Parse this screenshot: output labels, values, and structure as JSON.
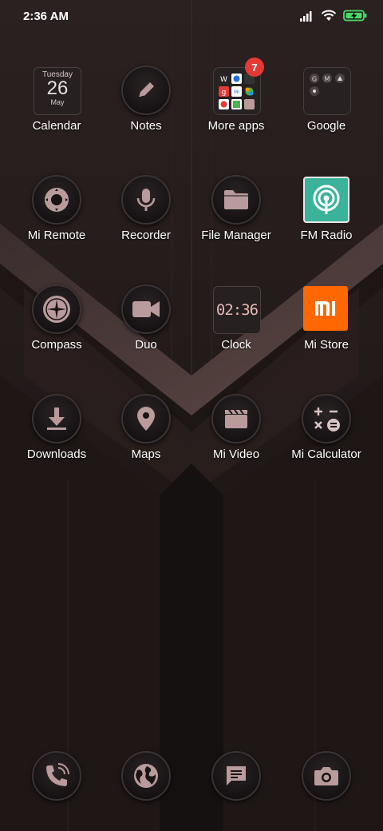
{
  "status": {
    "time": "2:36 AM"
  },
  "calendar": {
    "weekday": "Tuesday",
    "day": "26",
    "month": "May"
  },
  "clock_widget": {
    "text": "02:36"
  },
  "more_apps_badge": "7",
  "apps": [
    {
      "label": "Calendar"
    },
    {
      "label": "Notes"
    },
    {
      "label": "More apps"
    },
    {
      "label": "Google"
    },
    {
      "label": "Mi Remote"
    },
    {
      "label": "Recorder"
    },
    {
      "label": "File Manager"
    },
    {
      "label": "FM Radio"
    },
    {
      "label": "Compass"
    },
    {
      "label": "Duo"
    },
    {
      "label": "Clock"
    },
    {
      "label": "Mi Store"
    },
    {
      "label": "Downloads"
    },
    {
      "label": "Maps"
    },
    {
      "label": "Mi Video"
    },
    {
      "label": "Mi Calculator"
    }
  ],
  "dock": [
    {
      "icon": "phone-icon"
    },
    {
      "icon": "browser-globe-icon"
    },
    {
      "icon": "messages-icon"
    },
    {
      "icon": "camera-icon"
    }
  ],
  "colors": {
    "icon_glyph": "#b99b9b",
    "fm_radio": "#3bb39a",
    "mi_store": "#ff6700",
    "badge": "#e53935"
  }
}
